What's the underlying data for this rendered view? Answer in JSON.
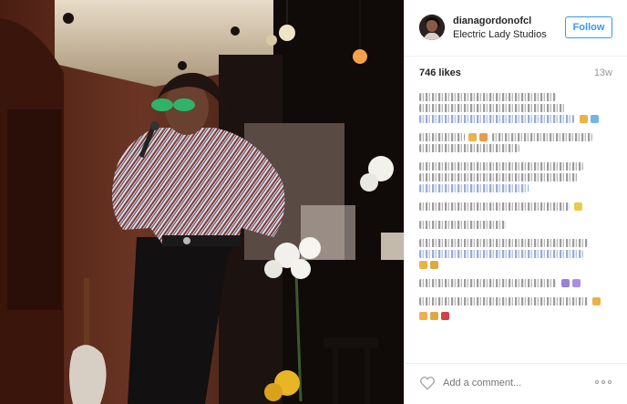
{
  "post": {
    "username": "dianagordonofcl",
    "location": "Electric Lady Studios",
    "follow_label": "Follow",
    "likes": "746 likes",
    "age": "13w",
    "comment_placeholder": "Add a comment..."
  },
  "icons": {
    "like": "heart-icon",
    "more": "more-options-icon",
    "avatar": "profile-avatar"
  },
  "colors": {
    "accent": "#3897f0",
    "text": "#262626",
    "muted": "#999999",
    "divider": "#efefef"
  }
}
